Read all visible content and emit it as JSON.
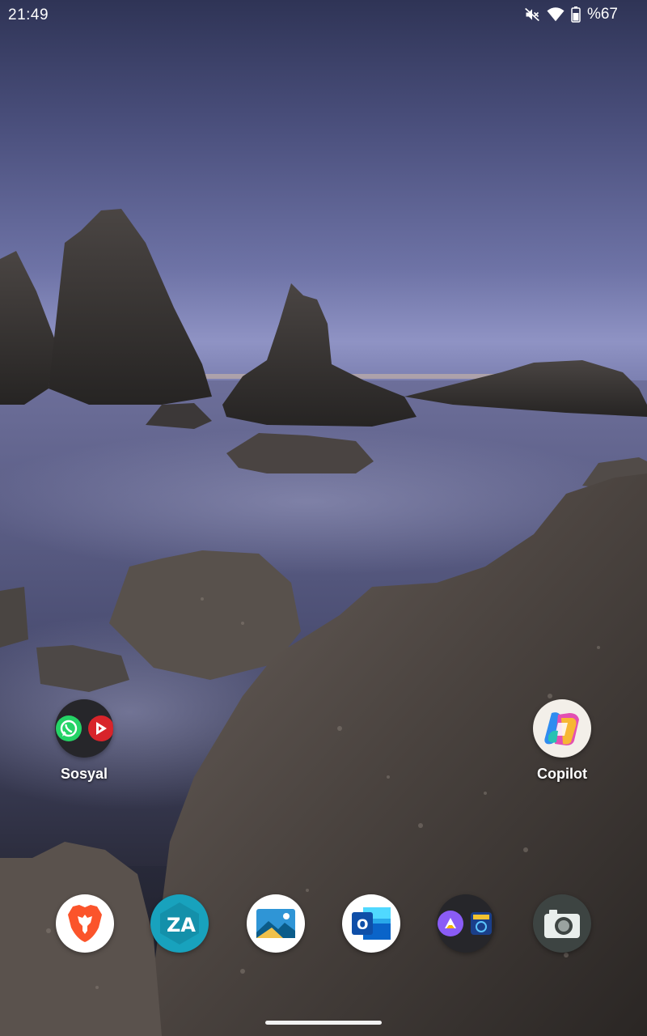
{
  "status_bar": {
    "time": "21:49",
    "battery_text": "%67",
    "icons": [
      "mute-icon",
      "wifi-icon",
      "battery-icon"
    ]
  },
  "home": {
    "folder_social": {
      "label": "Sosyal",
      "apps": [
        "whatsapp-icon",
        "youtube-vanced-icon"
      ]
    },
    "copilot": {
      "label": "Copilot"
    }
  },
  "dock": {
    "apps": [
      "brave-icon",
      "zarchiver-icon",
      "gallery-icon",
      "outlook-icon",
      "folder-icon",
      "camera-icon"
    ]
  },
  "colors": {
    "whatsapp": "#25d366",
    "red_app": "#d8242a",
    "brave": "#fb542b",
    "outlook": "#0a64c9",
    "zarchiver": "#18a2bd"
  }
}
